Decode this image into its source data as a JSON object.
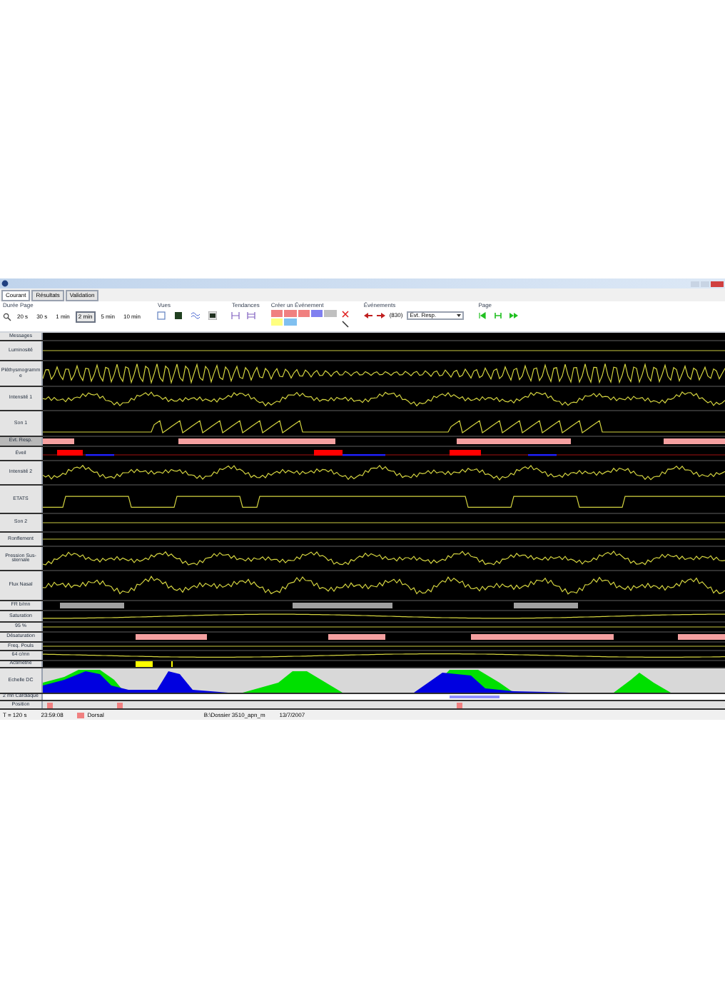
{
  "tabs": [
    {
      "label": "Courant",
      "selected": true
    },
    {
      "label": "Résultats",
      "selected": false
    },
    {
      "label": "Validation",
      "selected": false
    }
  ],
  "toolbar": {
    "page_duration": {
      "label": "Durée Page",
      "options": [
        {
          "label": "20 s",
          "selected": false
        },
        {
          "label": "30 s",
          "selected": false
        },
        {
          "label": "1 min",
          "selected": false
        },
        {
          "label": "2 min",
          "selected": true
        },
        {
          "label": "5 min",
          "selected": false
        },
        {
          "label": "10 min",
          "selected": false
        }
      ]
    },
    "views": {
      "label": "Vues"
    },
    "trends": {
      "label": "Tendances"
    },
    "create_event": {
      "label": "Créer un Événement",
      "buttons": [
        {
          "color": "#f08080"
        },
        {
          "color": "#f08080"
        },
        {
          "color": "#f08080"
        },
        {
          "color": "#8080f0"
        },
        {
          "color": "#c0c0c0"
        },
        {
          "color": "#ffff80"
        },
        {
          "color": "#80c0f0"
        }
      ]
    },
    "events": {
      "label": "Événements",
      "count": "(830)",
      "type": "Evt. Resp."
    },
    "page": {
      "label": "Page"
    }
  },
  "channels": [
    {
      "label": "Messages",
      "kind": "messages"
    },
    {
      "label": "Luminosité",
      "kind": "flat"
    },
    {
      "label": "Pléthysmogramme",
      "kind": "oscillation"
    },
    {
      "label": "Intensité 1",
      "kind": "trace"
    },
    {
      "label": "Son 1",
      "kind": "spikes"
    },
    {
      "label": "Evt. Resp.",
      "kind": "events"
    },
    {
      "label": "Éveil",
      "kind": "markers"
    },
    {
      "label": "Intensité 2",
      "kind": "trace"
    },
    {
      "label": "ETATS",
      "kind": "steps"
    },
    {
      "label": "Son 2",
      "kind": "flat"
    },
    {
      "label": "Ronflement",
      "kind": "flat"
    },
    {
      "label": "Pression Sus-sternale",
      "kind": "trace"
    },
    {
      "label": "Flux Nasal",
      "kind": "trace"
    },
    {
      "label": "FR b/mn",
      "kind": "boxes"
    },
    {
      "label": "Saturation",
      "kind": "slow"
    },
    {
      "label": "95 %",
      "kind": "flat"
    },
    {
      "label": "Désaturation",
      "kind": "events"
    },
    {
      "label": "Freq. Pouls",
      "kind": "flat"
    },
    {
      "label": "64 c/mn",
      "kind": "slow"
    },
    {
      "label": "Actimétrie",
      "kind": "activity"
    },
    {
      "label": "Echelle DC",
      "kind": "histogram"
    },
    {
      "label": "2 mn Cardiaque",
      "kind": "strip"
    },
    {
      "label": "Position",
      "kind": "position"
    }
  ],
  "status_bar": {
    "scale": "T = 120 s",
    "time": "23:59:08",
    "position": {
      "label": "Dorsal",
      "color": "#f08080"
    },
    "file": "B:\\Dossier 3510_apn_m",
    "date": "13/7/2007"
  }
}
